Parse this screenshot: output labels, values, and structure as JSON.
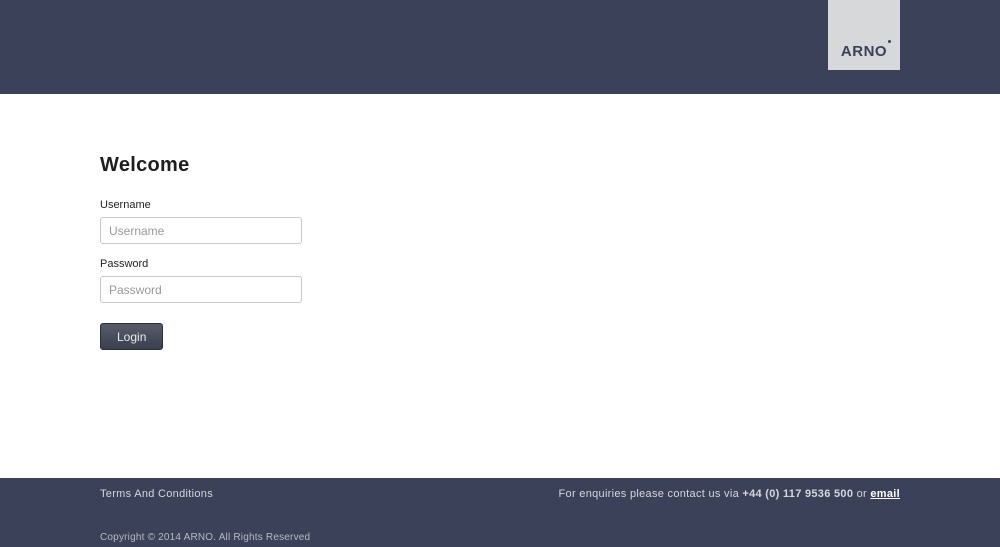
{
  "header": {
    "logo_text": "ARNO"
  },
  "main": {
    "heading": "Welcome",
    "username": {
      "label": "Username",
      "placeholder": "Username",
      "value": ""
    },
    "password": {
      "label": "Password",
      "placeholder": "Password",
      "value": ""
    },
    "login_button": "Login"
  },
  "footer": {
    "terms_label": "Terms And Conditions",
    "enquiry_prefix": "For enquiries please contact us via ",
    "phone": "+44 (0) 117 9536 500",
    "enquiry_or": " or ",
    "email_label": "email",
    "copyright": "Copyright © 2014 ARNO. All Rights Reserved"
  }
}
